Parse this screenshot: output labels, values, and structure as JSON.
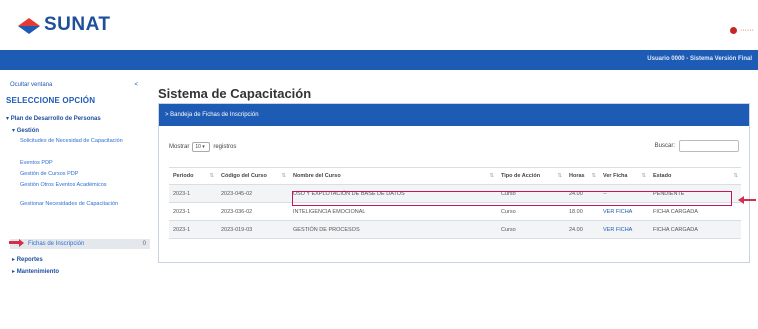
{
  "header": {
    "logo_text": "SUNAT",
    "user_label": "······",
    "session_text": "Usuario 0000 - Sistema Versión Final"
  },
  "sidebar": {
    "toggle_label": "Ocultar ventana",
    "toggle_count": "<",
    "section_title": "SELECCIONE OPCIÓN",
    "items": [
      {
        "label": "Plan de Desarrollo de Personas"
      },
      {
        "label": "Gestión"
      }
    ],
    "subitems": [
      {
        "label": "Solicitudes de Necesidad de Capacitación"
      },
      {
        "label": "Eventos PDP"
      },
      {
        "label": "Gestión de Cursos PDP"
      },
      {
        "label": "Gestión Otros Eventos Académicos"
      },
      {
        "label": "Gestionar Necesidades de Capacitación"
      }
    ],
    "active_item": {
      "label": "Fichas de Inscripción",
      "count": "0"
    },
    "bottom_items": [
      {
        "label": "Reportes"
      },
      {
        "label": "Mantenimiento"
      }
    ]
  },
  "main": {
    "title": "Sistema de Capacitación",
    "panel_title": "> Bandeja de Fichas de Inscripción",
    "controls": {
      "show_label": "Mostrar",
      "page_size": "10",
      "records_label": "registros"
    },
    "search_label": "Buscar:",
    "table": {
      "columns": [
        "Periodo",
        "Código del Curso",
        "Nombre del Curso",
        "Tipo de Acción",
        "Horas",
        "Ver Ficha",
        "Estado"
      ],
      "rows": [
        {
          "periodo": "2023-1",
          "codigo": "2023-045-02",
          "nombre": "USO Y EXPLOTACIÓN DE BASE DE DATOS",
          "tipo": "Curso",
          "horas": "24.00",
          "ficha": "--",
          "estado": "PENDIENTE"
        },
        {
          "periodo": "2023-1",
          "codigo": "2023-036-02",
          "nombre": "INTELIGENCIA EMOCIONAL",
          "tipo": "Curso",
          "horas": "18.00",
          "ficha": "VER FICHA",
          "estado": "FICHA CARGADA"
        },
        {
          "periodo": "2023-1",
          "codigo": "2023-019-03",
          "nombre": "GESTIÓN DE PROCESOS",
          "tipo": "Curso",
          "horas": "24.00",
          "ficha": "VER FICHA",
          "estado": "FICHA CARGADA"
        }
      ]
    }
  },
  "colors": {
    "brand_blue": "#1e5bb5",
    "highlight": "#c2185b",
    "arrow": "#d32f4d"
  },
  "icons": {
    "logo": "sunat-logo-icon",
    "pointer": "arrow-left-icon",
    "sidebar_pointer": "arrow-right-icon"
  }
}
